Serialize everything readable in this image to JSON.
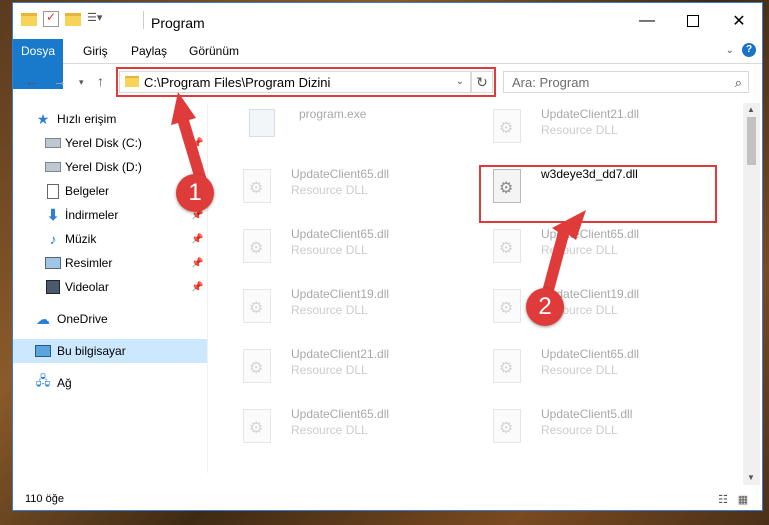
{
  "window": {
    "title": "Program"
  },
  "ribbon": {
    "tabs": [
      "Dosya",
      "Giriş",
      "Paylaş",
      "Görünüm"
    ]
  },
  "nav": {
    "address": "C:\\Program Files\\Program Dizini",
    "search_placeholder": "Ara: Program"
  },
  "sidebar": {
    "items": [
      {
        "label": "Hızlı erişim",
        "icon": "star-icon"
      },
      {
        "label": "Yerel Disk (C:)",
        "icon": "drive-icon"
      },
      {
        "label": "Yerel Disk (D:)",
        "icon": "drive-icon"
      },
      {
        "label": "Belgeler",
        "icon": "documents-icon"
      },
      {
        "label": "İndirmeler",
        "icon": "download-icon"
      },
      {
        "label": "Müzik",
        "icon": "music-icon"
      },
      {
        "label": "Resimler",
        "icon": "pictures-icon"
      },
      {
        "label": "Videolar",
        "icon": "video-icon"
      },
      {
        "label": "OneDrive",
        "icon": "cloud-icon"
      },
      {
        "label": "Bu bilgisayar",
        "icon": "computer-icon"
      },
      {
        "label": "Ağ",
        "icon": "network-icon"
      }
    ]
  },
  "files": [
    {
      "name": "program.exe",
      "type": ""
    },
    {
      "name": "UpdateClient21.dll",
      "type": "Resource DLL"
    },
    {
      "name": "UpdateClient65.dll",
      "type": "Resource DLL"
    },
    {
      "name": "w3deye3d_dd7.dll",
      "type": ""
    },
    {
      "name": "UpdateClient65.dll",
      "type": "Resource DLL"
    },
    {
      "name": "UpdateClient65.dll",
      "type": "Resource DLL"
    },
    {
      "name": "UpdateClient19.dll",
      "type": "Resource DLL"
    },
    {
      "name": "UpdateClient19.dll",
      "type": "Resource DLL"
    },
    {
      "name": "UpdateClient21.dll",
      "type": "Resource DLL"
    },
    {
      "name": "UpdateClient65.dll",
      "type": "Resource DLL"
    },
    {
      "name": "UpdateClient65.dll",
      "type": "Resource DLL"
    },
    {
      "name": "UpdateClient5.dll",
      "type": "Resource DLL"
    }
  ],
  "status": {
    "item_count": "110 öğe"
  },
  "annotations": {
    "badge1": "1",
    "badge2": "2",
    "color": "#e03b3b"
  }
}
